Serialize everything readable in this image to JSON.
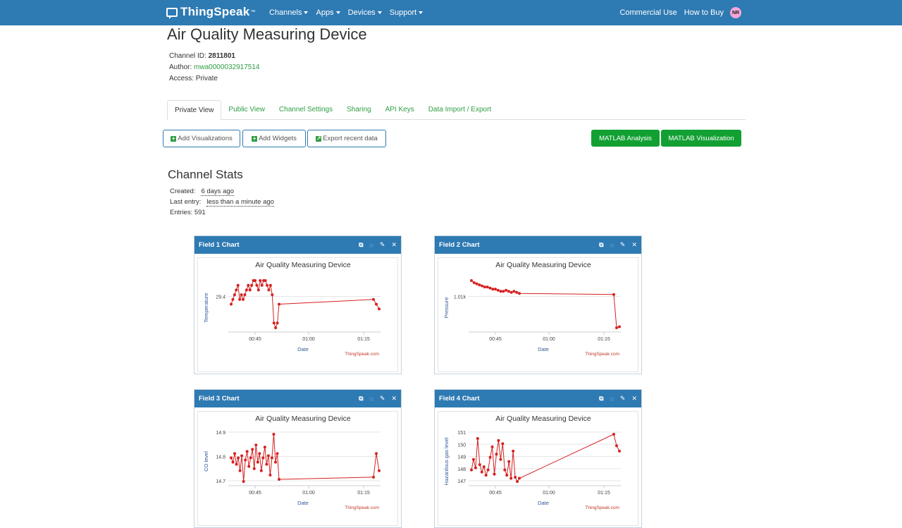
{
  "nav": {
    "brand": "ThingSpeak",
    "brand_tm": "™",
    "menu": [
      "Channels",
      "Apps",
      "Devices",
      "Support"
    ],
    "right_links": [
      "Commercial Use",
      "How to Buy"
    ],
    "avatar_initials": "NR",
    "color": "#2e7ab3"
  },
  "channel": {
    "title": "Air Quality Measuring Device",
    "id_label": "Channel ID:",
    "id_value": "2811801",
    "author_label": "Author:",
    "author_value": "mwa0000032917514",
    "access_label": "Access:",
    "access_value": "Private"
  },
  "tabs": [
    "Private View",
    "Public View",
    "Channel Settings",
    "Sharing",
    "API Keys",
    "Data Import / Export"
  ],
  "active_tab": "Private View",
  "buttons": {
    "add_visualizations": "Add Visualizations",
    "add_widgets": "Add Widgets",
    "export_recent": "Export recent data",
    "matlab_analysis": "MATLAB Analysis",
    "matlab_visualization": "MATLAB Visualization"
  },
  "stats": {
    "title": "Channel Stats",
    "created_label": "Created:",
    "created_value": "6 days ago",
    "last_entry_label": "Last entry:",
    "last_entry_value": "less than a minute ago",
    "entries_label": "Entries:",
    "entries_value": "591"
  },
  "panel_icons": [
    "external-link-icon",
    "comment-icon",
    "pencil-icon",
    "close-icon"
  ],
  "chart_data": [
    {
      "type": "line",
      "panel_title": "Field 1 Chart",
      "title": "Air Quality Measuring Device",
      "xlabel": "Date",
      "ylabel": "Temperature",
      "credit": "ThingSpeak.com",
      "x_ticks": [
        "00:45",
        "01:00",
        "01:15"
      ],
      "y_ticks": [
        "29.4"
      ],
      "color": "#d62020",
      "series": [
        {
          "values": [
            29.3,
            29.4,
            29.5,
            29.6,
            29.7,
            29.4,
            29.5,
            29.4,
            29.5,
            29.6,
            29.7,
            29.6,
            29.7,
            29.8,
            29.8,
            29.7,
            29.6,
            29.8,
            29.7,
            29.8,
            29.8,
            29.7,
            29.6,
            29.7,
            29.5,
            28.9,
            28.8,
            28.9,
            29.3,
            29.4,
            29.3,
            29.2
          ]
        }
      ]
    },
    {
      "type": "line",
      "panel_title": "Field 2 Chart",
      "title": "Air Quality Measuring Device",
      "xlabel": "Date",
      "ylabel": "Pressure",
      "credit": "ThingSpeak.com",
      "x_ticks": [
        "00:45",
        "01:00",
        "01:15"
      ],
      "y_ticks": [
        "1.01k"
      ],
      "color": "#d62020",
      "series": [
        {
          "values": [
            1010,
            1009,
            1008.5,
            1008,
            1007.5,
            1007,
            1007,
            1006.5,
            1006,
            1006,
            1005.5,
            1005,
            1005,
            1005.5,
            1005,
            1004.5,
            1005,
            1004.5,
            1004,
            1003.5,
            988,
            988.5
          ]
        }
      ]
    },
    {
      "type": "line",
      "panel_title": "Field 3 Chart",
      "title": "Air Quality Measuring Device",
      "xlabel": "Date",
      "ylabel": "CO level",
      "credit": "ThingSpeak.com",
      "x_ticks": [
        "00:45",
        "01:00",
        "01:15"
      ],
      "y_ticks": [
        "14.9",
        "14.8",
        "14.7"
      ],
      "color": "#d62020",
      "series": [
        {
          "values": [
            14.8,
            14.78,
            14.82,
            14.77,
            14.8,
            14.74,
            14.81,
            14.69,
            14.79,
            14.83,
            14.76,
            14.8,
            14.84,
            14.75,
            14.86,
            14.78,
            14.82,
            14.74,
            14.8,
            14.85,
            14.77,
            14.81,
            14.72,
            14.8,
            14.91,
            14.78,
            14.82,
            14.7,
            14.71,
            14.82,
            14.74
          ]
        }
      ]
    },
    {
      "type": "line",
      "panel_title": "Field 4 Chart",
      "title": "Air Quality Measuring Device",
      "xlabel": "Date",
      "ylabel": "Hazardous gas level",
      "credit": "ThingSpeak.com",
      "x_ticks": [
        "00:45",
        "01:00",
        "01:15"
      ],
      "y_ticks": [
        "151",
        "150",
        "149",
        "148",
        "147"
      ],
      "color": "#d62020",
      "series": [
        {
          "values": [
            148,
            149,
            148.2,
            151,
            148.5,
            147.8,
            148.3,
            147.5,
            148,
            149.2,
            150.2,
            147.6,
            149.5,
            150.8,
            149,
            150.5,
            148,
            147.5,
            148.8,
            147.2,
            149.8,
            147.3,
            146.9,
            147.2,
            151.4,
            150.3,
            149.8
          ]
        }
      ]
    }
  ]
}
